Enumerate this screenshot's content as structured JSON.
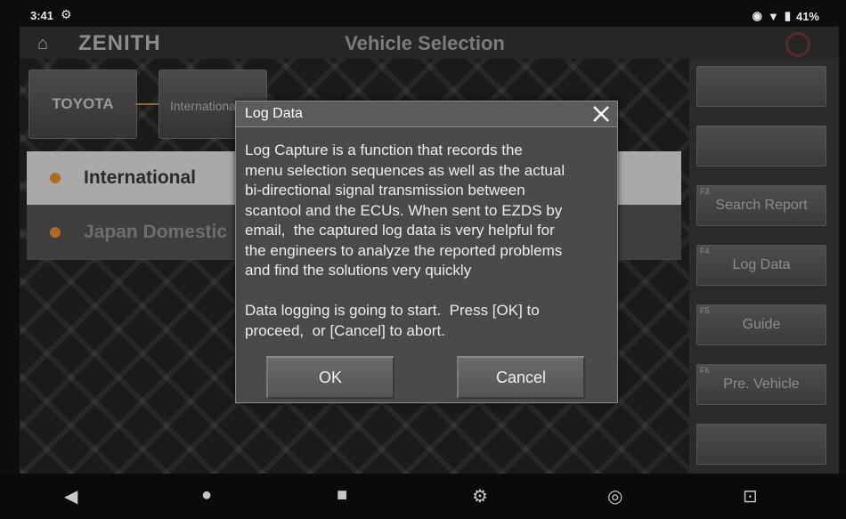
{
  "status_bar": {
    "time": "3:41",
    "battery": "41%"
  },
  "header": {
    "logo": "ZENITH",
    "title": "Vehicle Selection"
  },
  "breadcrumb": {
    "brand": "TOYOTA",
    "region": "International"
  },
  "region_list": [
    {
      "label": "International",
      "selected": true
    },
    {
      "label": "Japan Domestic",
      "selected": false
    }
  ],
  "side_menu": [
    {
      "key": "",
      "label": ""
    },
    {
      "key": "",
      "label": ""
    },
    {
      "key": "F3",
      "label": "Search Report"
    },
    {
      "key": "F4",
      "label": "Log Data"
    },
    {
      "key": "F5",
      "label": "Guide"
    },
    {
      "key": "F6",
      "label": "Pre. Vehicle"
    },
    {
      "key": "",
      "label": ""
    }
  ],
  "dialog": {
    "title": "Log Data",
    "body": "Log Capture is a function that records the\nmenu selection sequences as well as the actual\nbi-directional signal transmission between\nscantool and the ECUs. When sent to EZDS by\nemail,  the captured log data is very helpful for\nthe engineers to analyze the reported problems\nand find the solutions very quickly\n\nData logging is going to start.  Press [OK] to\nproceed,  or [Cancel] to abort.",
    "ok_label": "OK",
    "cancel_label": "Cancel"
  },
  "colors": {
    "accent_dot": "#b06a1e",
    "selected_row": "#a9a9a9",
    "dialog_bg": "#4a4a4a"
  }
}
